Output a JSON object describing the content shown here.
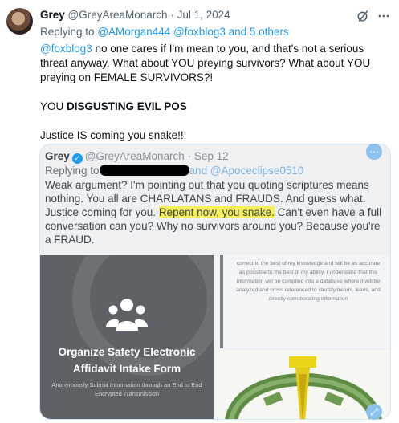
{
  "tweet": {
    "author_name": "Grey",
    "author_handle": "@GreyAreaMonarch",
    "separator": "·",
    "date": "Jul 1, 2024",
    "replying_prefix": "Replying to",
    "reply_mention_1": "@AMorgan444",
    "reply_mention_2": "@foxblog3",
    "reply_connector": "and",
    "reply_others": "5 others",
    "body_mention": "@foxblog3",
    "body_line_1_rest": " no one cares if I'm mean to you, and that's not a serious threat anyway. What about YOU preying survivors? What about YOU preying on FEMALE SURVIVORS?!",
    "body_line_2_prefix": "YOU ",
    "body_line_2_bold": "DISGUSTING EVIL POS",
    "body_line_3": "Justice IS coming you snake!!!",
    "icons": {
      "grok": "grok-slash-icon",
      "more": "more-icon"
    }
  },
  "quoted": {
    "author_name": "Grey",
    "author_handle": "@GreyAreaMonarch",
    "separator": "·",
    "date": "Sep 12",
    "replying_prefix": "Replying to",
    "reply_tail_and": "and",
    "reply_tail_mention": "@Apoceclipse0510",
    "text_1": "Weak argument? I'm pointing out that you quoting scriptures means nothing. You all are CHARLATANS and FRAUDS. And guess what. Justice coming for you.  ",
    "highlight": "Repent now, you snake.",
    "text_2": " Can't even have a full conversation can you? Why no survivors around you? Because you're  a FRAUD.",
    "image_left": {
      "title_line_1": "Organize Safety Electronic",
      "title_line_2": "Affidavit Intake Form",
      "subtitle": "Anonymously Submit Information through an End to End Encrypted Transmission"
    },
    "image_right_text": "correct to the best of my knowledge and will be as accurate as possible to the best of my ability. I understand that this information will be compiled into a database where it will be analyzed and cross referenced to identify trends, leads, and directly corroborating information",
    "icons": {
      "top_button": "more-dots-icon",
      "bottom_button": "expand-icon"
    }
  },
  "colors": {
    "link": "#1d9bf0",
    "highlight": "#f7f05b"
  }
}
